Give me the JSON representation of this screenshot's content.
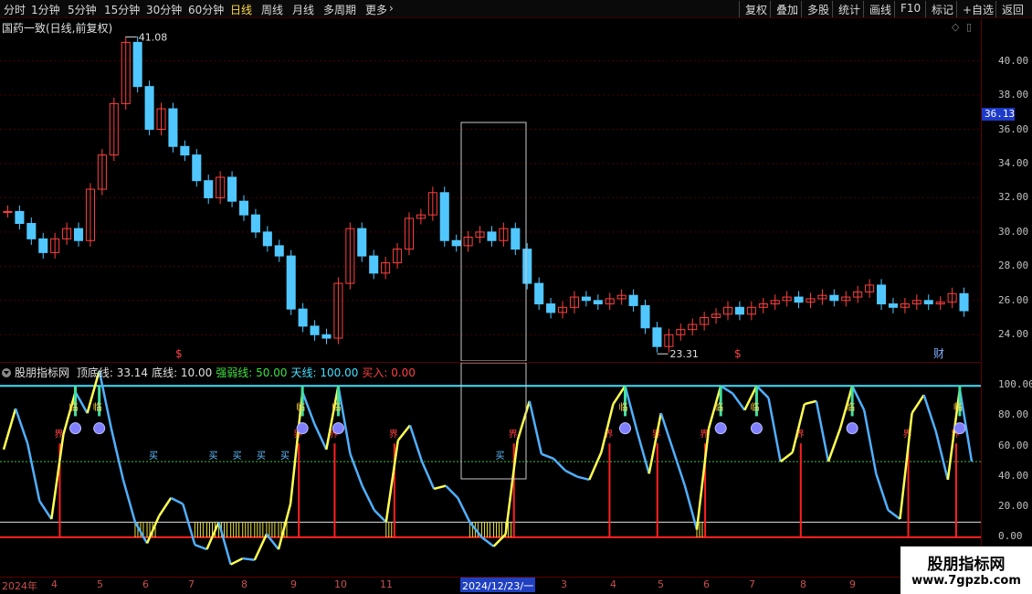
{
  "toolbar": {
    "timeframes": [
      "分时",
      "1分钟",
      "5分钟",
      "15分钟",
      "30分钟",
      "60分钟",
      "日线",
      "周线",
      "月线",
      "多周期",
      "更多"
    ],
    "active_timeframe": "日线",
    "buttons": [
      "复权",
      "叠加",
      "多股",
      "统计",
      "画线",
      "F10",
      "标记",
      "+自选",
      "返回"
    ]
  },
  "main_pane": {
    "title": "国药一致(日线,前复权)",
    "high_label": "41.08",
    "low_label": "23.31",
    "current_price": "36.13",
    "price_ticks": [
      "40.00",
      "38.00",
      "36.00",
      "34.00",
      "32.00",
      "30.00",
      "28.00",
      "26.00",
      "24.00"
    ],
    "event_markers": [
      "$",
      "$",
      "财"
    ]
  },
  "indicator_pane": {
    "name": "股朋指标网",
    "params": [
      {
        "label": "顶底线:",
        "value": "33.14",
        "color": "#e0e0e0"
      },
      {
        "label": "底线:",
        "value": "10.00",
        "color": "#e0e0e0"
      },
      {
        "label": "强弱线:",
        "value": "50.00",
        "color": "#40e040"
      },
      {
        "label": "天线:",
        "value": "100.00",
        "color": "#40e0ff"
      },
      {
        "label": "买入:",
        "value": "0.00",
        "color": "#ff4040"
      }
    ],
    "ticks": [
      "100.00",
      "80.00",
      "60.00",
      "40.00",
      "20.00",
      "0.00"
    ],
    "signal_labels": {
      "buy": "买",
      "boundary": "界",
      "near": "临"
    }
  },
  "x_axis": {
    "labels": [
      "2024年",
      "4",
      "5",
      "6",
      "7",
      "8",
      "9",
      "10",
      "11",
      "2024/12/23/一",
      "3",
      "4",
      "5",
      "6",
      "7",
      "8",
      "9"
    ]
  },
  "watermark": {
    "title": "股朋指标网",
    "url": "www.7gpzb.com"
  },
  "colors": {
    "up": "#ff4040",
    "down": "#50c8ff",
    "osc_up": "#ffff50",
    "osc_down": "#50b0ff",
    "sky_line": "#40e0ff",
    "buy_line": "#ff2020"
  },
  "chart_data": {
    "type": "line",
    "title": "国药一致(日线,前复权)",
    "price_ylim": [
      23.0,
      41.9
    ],
    "price_closes": [
      31.2,
      30.5,
      29.6,
      28.8,
      29.6,
      30.2,
      29.5,
      32.5,
      34.5,
      37.5,
      41.08,
      38.5,
      36.0,
      37.2,
      35.0,
      34.5,
      33.0,
      32.0,
      33.2,
      31.8,
      31.0,
      30.0,
      29.2,
      28.6,
      25.5,
      24.5,
      24.0,
      23.8,
      27.0,
      30.2,
      28.6,
      27.6,
      28.2,
      29.0,
      30.8,
      31.0,
      32.3,
      29.5,
      29.2,
      29.7,
      30.0,
      29.5,
      30.2,
      29.0,
      27.0,
      25.8,
      25.3,
      25.6,
      26.2,
      26.0,
      25.8,
      26.1,
      26.3,
      25.7,
      24.4,
      23.31,
      24.0,
      24.3,
      24.6,
      25.0,
      25.2,
      25.6,
      25.2,
      25.6,
      25.8,
      26.0,
      26.2,
      25.9,
      26.1,
      26.3,
      26.0,
      26.2,
      26.5,
      26.9,
      25.8,
      25.6,
      25.8,
      26.0,
      25.8,
      25.9,
      26.4,
      25.4
    ],
    "osc_ylim": [
      -20,
      102
    ],
    "oscillator": [
      58,
      85,
      62,
      24,
      12,
      68,
      96,
      82,
      110,
      72,
      38,
      10,
      -4,
      14,
      26,
      22,
      -5,
      -8,
      10,
      -18,
      -14,
      -15,
      2,
      -8,
      22,
      96,
      75,
      58,
      100,
      55,
      34,
      18,
      10,
      64,
      74,
      50,
      32,
      34,
      26,
      10,
      0,
      -6,
      2,
      64,
      90,
      55,
      52,
      44,
      40,
      38,
      56,
      88,
      100,
      70,
      42,
      82,
      58,
      34,
      5,
      72,
      100,
      95,
      84,
      100,
      92,
      50,
      56,
      88,
      90,
      50,
      72,
      100,
      84,
      42,
      18,
      12,
      82,
      94,
      70,
      38,
      98,
      50
    ]
  }
}
